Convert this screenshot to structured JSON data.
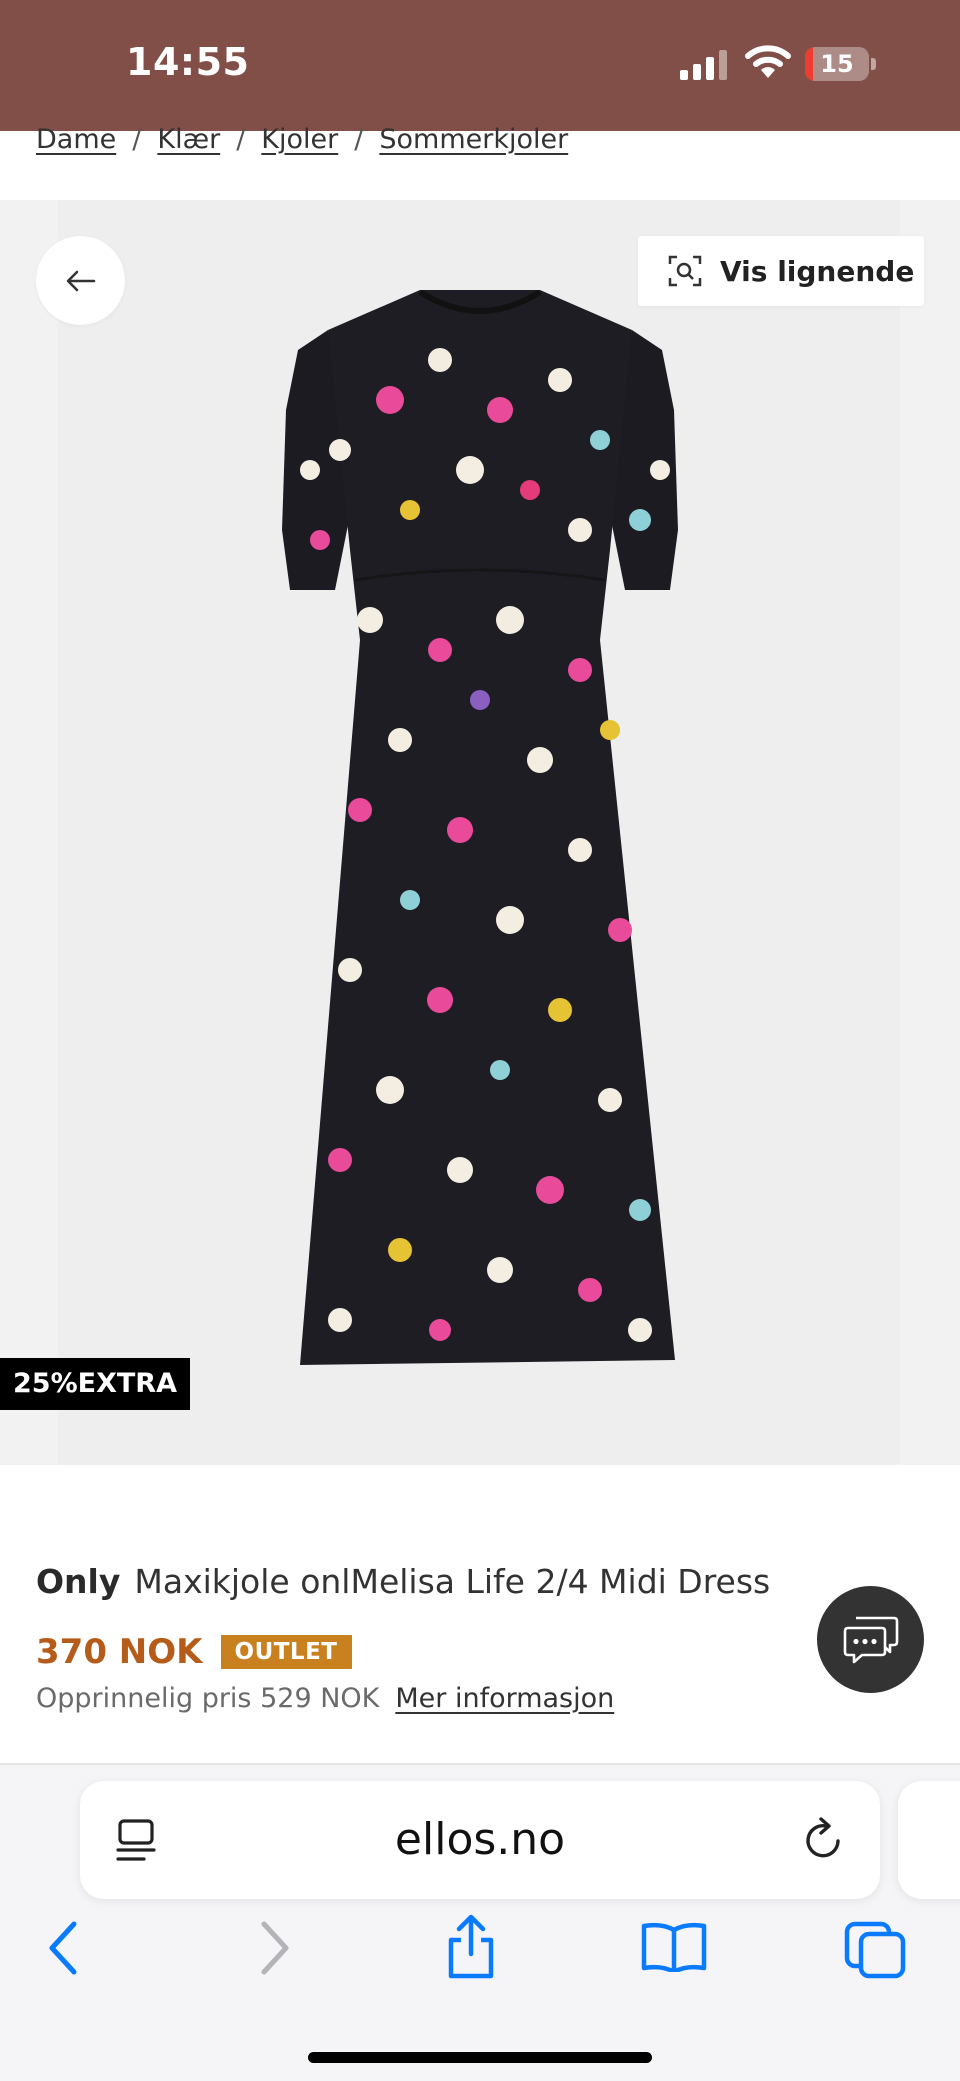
{
  "status_bar": {
    "time": "14:55",
    "battery_level": "15"
  },
  "breadcrumb": [
    {
      "label": "Dame"
    },
    {
      "label": "Klær"
    },
    {
      "label": "Kjoler"
    },
    {
      "label": "Sommerkjoler"
    }
  ],
  "breadcrumb_separator": "/",
  "gallery": {
    "similar_button_label": "Vis lignende",
    "promo_badge": "25%EXTRA"
  },
  "product": {
    "brand": "Only",
    "name": "Maxikjole onlMelisa Life 2/4 Midi Dress",
    "price": "370 NOK",
    "badge": "OUTLET",
    "original_price_text": "Opprinnelig pris 529 NOK",
    "more_info_link": "Mer informasjon"
  },
  "browser": {
    "url": "ellos.no"
  },
  "colors": {
    "status_bar_bg": "#814f48",
    "price": "#b65c1b",
    "outlet_badge": "#c9811f",
    "ios_blue": "#0a7aff"
  },
  "icons": {
    "back": "arrow-left-icon",
    "similar": "visual-search-icon",
    "chat": "chat-bubble-icon",
    "reader": "reader-mode-icon",
    "reload": "reload-icon",
    "nav_back": "chevron-left-icon",
    "nav_forward": "chevron-right-icon",
    "share": "share-icon",
    "bookmarks": "book-icon",
    "tabs": "tabs-icon"
  }
}
